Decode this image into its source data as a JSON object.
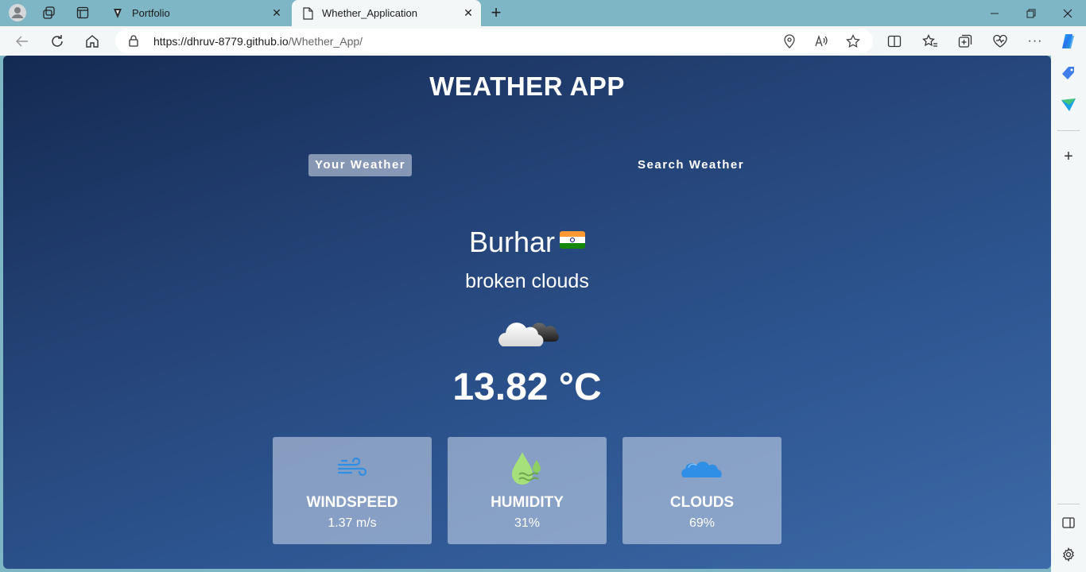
{
  "browser": {
    "tabs": [
      {
        "title": "Portfolio",
        "close": "✕"
      },
      {
        "title": "Whether_Application",
        "close": "✕"
      }
    ],
    "new_tab": "+",
    "url_host": "https://dhruv-8779.github.io",
    "url_path": "/Whether_App/",
    "window_controls": {
      "minimize": "—",
      "maximize": "❐",
      "close": "✕"
    }
  },
  "app": {
    "title": "WEATHER APP",
    "tabs": {
      "your": "Your Weather",
      "search": "Search Weather"
    },
    "city": "Burhar",
    "description": "broken clouds",
    "temperature": "13.82 °C",
    "stats": [
      {
        "label": "WINDSPEED",
        "value": "1.37 m/s",
        "icon": "wind-icon"
      },
      {
        "label": "HUMIDITY",
        "value": "31%",
        "icon": "humidity-icon"
      },
      {
        "label": "CLOUDS",
        "value": "69%",
        "icon": "clouds-icon"
      }
    ]
  },
  "colors": {
    "accent": "#3d6aa8",
    "card": "#bccde4",
    "browser_frame": "#7fb6c6"
  }
}
